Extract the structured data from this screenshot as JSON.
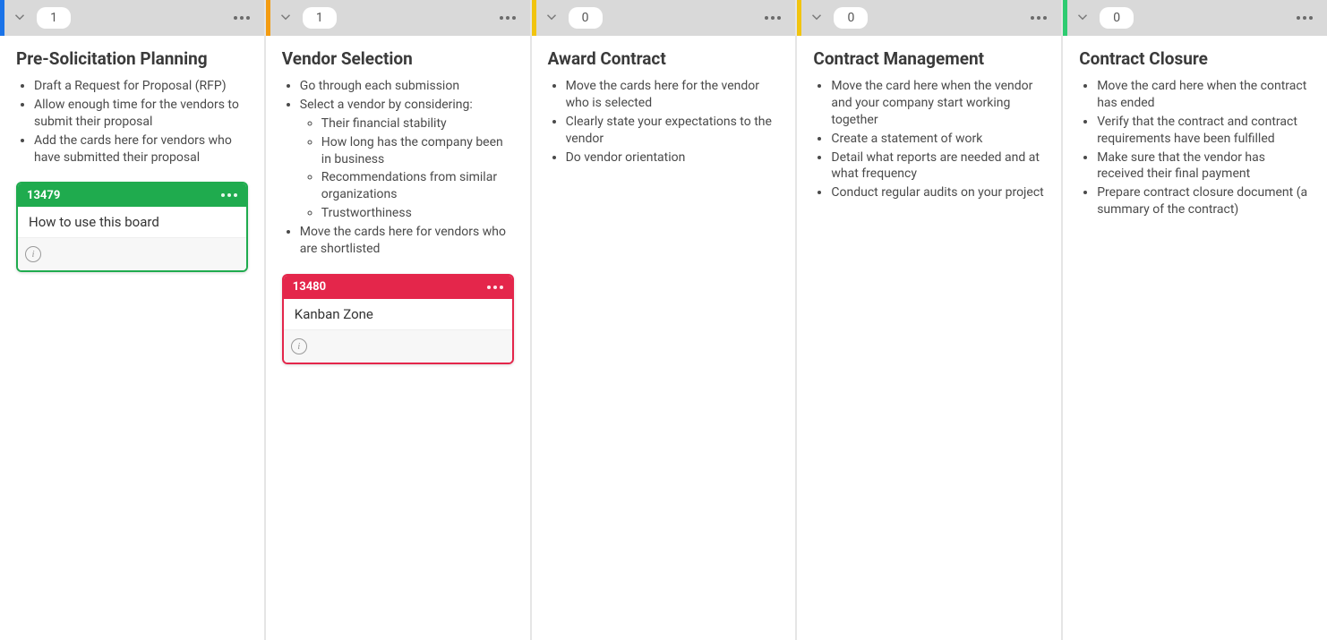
{
  "columns": [
    {
      "accent": "#1a73e8",
      "count": "1",
      "title": "Pre-Solicitation Planning",
      "desc_html": "<ul><li>Draft a Request for Proposal (RFP)</li><li>Allow enough time for the vendors to submit their proposal</li><li>Add the cards here for vendors who have submitted their proposal</li></ul>",
      "cards": [
        {
          "id": "13479",
          "title": "How to use this board",
          "color": "#1fab4e"
        }
      ]
    },
    {
      "accent": "#f39c12",
      "count": "1",
      "title": "Vendor Selection",
      "desc_html": "<ul><li>Go through each submission</li><li>Select a vendor by considering:<ul><li>Their financial stability</li><li>How long has the company been in business</li><li>Recommendations from similar organizations</li><li>Trustworthiness</li></ul></li><li>Move the cards here for vendors who are shortlisted</li></ul>",
      "cards": [
        {
          "id": "13480",
          "title": "Kanban Zone",
          "color": "#e4264b"
        }
      ]
    },
    {
      "accent": "#f1c40f",
      "count": "0",
      "title": "Award Contract",
      "desc_html": "<ul><li>Move the cards here for the vendor who is selected</li><li>Clearly state your expectations to the vendor</li><li>Do vendor orientation</li></ul>",
      "cards": []
    },
    {
      "accent": "#f1c40f",
      "count": "0",
      "title": "Contract Management",
      "desc_html": "<ul><li>Move the card here when the vendor and your company start working together</li><li>Create a statement of work</li><li>Detail what reports are needed and at what frequency</li><li>Conduct regular audits on your project</li></ul>",
      "cards": []
    },
    {
      "accent": "#2ecc71",
      "count": "0",
      "title": "Contract Closure",
      "desc_html": "<ul><li>Move the card here when the contract has ended</li><li>Verify that the contract and contract requirements have been fulfilled</li><li>Make sure that the vendor has received their final payment</li><li>Prepare contract closure document (a summary of the contract)</li></ul>",
      "cards": []
    }
  ]
}
